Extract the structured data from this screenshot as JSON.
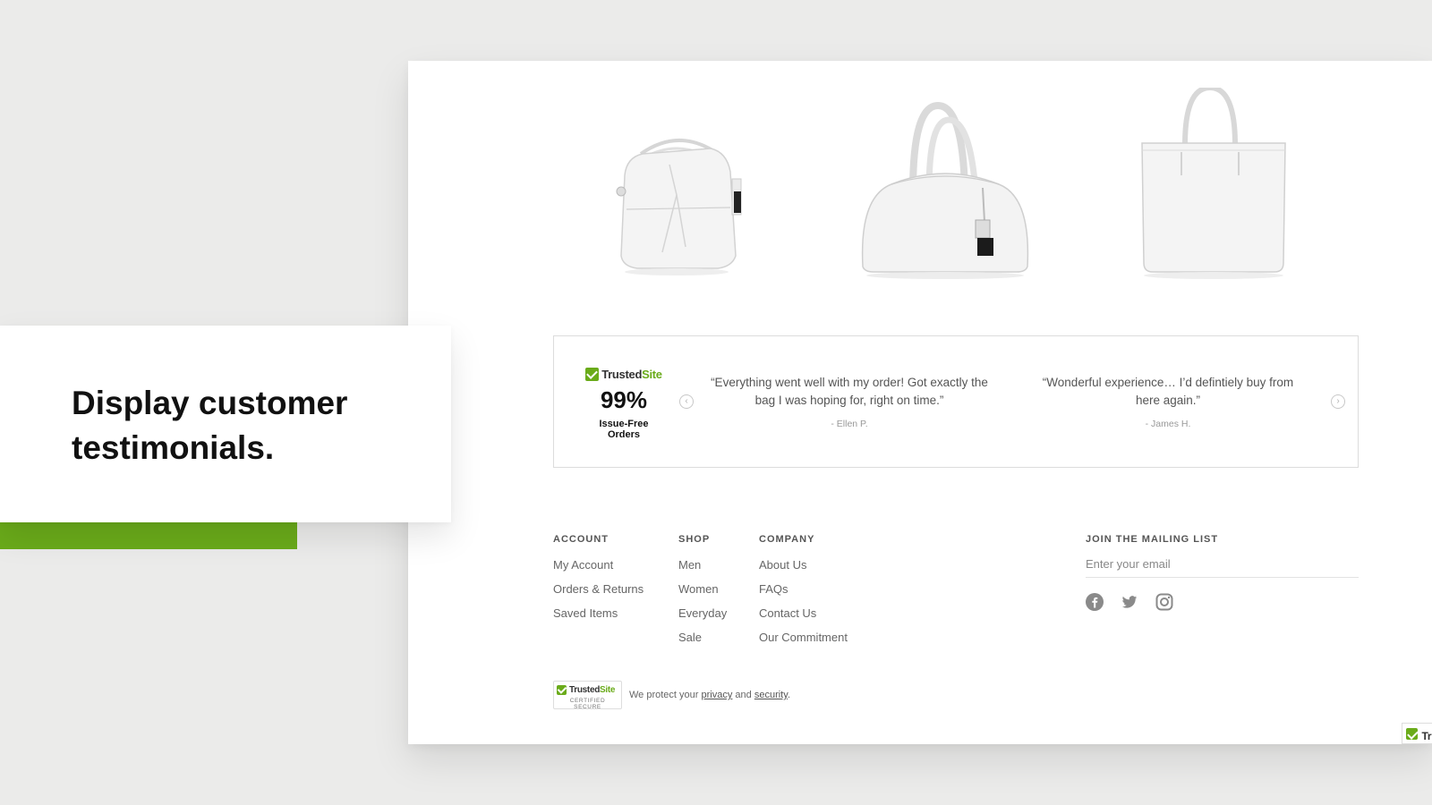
{
  "callout": {
    "title": "Display customer testimonials."
  },
  "products": [
    "handbag-hobo-white",
    "handbag-dome-satchel-white",
    "handbag-tote-white"
  ],
  "trust_badge": {
    "brand_trusted": "Trusted",
    "brand_site": "Site",
    "stat": "99%",
    "stat_label": "Issue-Free Orders"
  },
  "testimonials": [
    {
      "text": "“Everything went well with my order! Got exactly the bag I was hoping for, right on time.”",
      "author": "- Ellen P."
    },
    {
      "text": "“Wonderful experience… I’d defintiely buy from here again.”",
      "author": "- James H."
    }
  ],
  "footer": {
    "account": {
      "heading": "ACCOUNT",
      "links": [
        "My Account",
        "Orders & Returns",
        "Saved Items"
      ]
    },
    "shop": {
      "heading": "SHOP",
      "links": [
        "Men",
        "Women",
        "Everyday",
        "Sale"
      ]
    },
    "company": {
      "heading": "COMPANY",
      "links": [
        "About Us",
        "FAQs",
        "Contact Us",
        "Our Commitment"
      ]
    },
    "mailing": {
      "heading": "JOIN THE MAILING LIST",
      "placeholder": "Enter your email"
    },
    "social": [
      "facebook-icon",
      "twitter-icon",
      "instagram-icon"
    ]
  },
  "secure": {
    "badge_trusted": "Trusted",
    "badge_site": "Site",
    "badge_sub": "CERTIFIED SECURE",
    "text_before": "We protect your",
    "link_privacy": "privacy",
    "text_and": "and",
    "link_security": "security",
    "text_end": "."
  },
  "corner_badge": {
    "label": "Tru"
  },
  "colors": {
    "accent": "#6aab1a",
    "background": "#ebebea"
  }
}
